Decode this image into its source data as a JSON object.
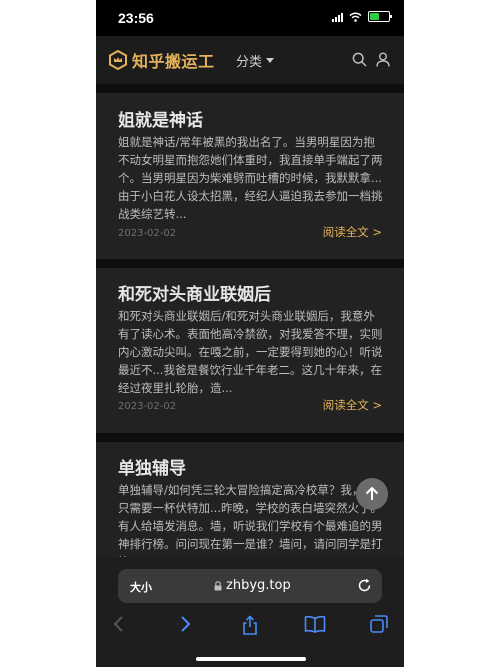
{
  "status_bar": {
    "time": "23:56"
  },
  "header": {
    "logo_text": "知乎搬运工",
    "category_label": "分类",
    "brand_color": "#e4b25a",
    "icons": [
      "search-icon",
      "user-icon"
    ]
  },
  "articles": [
    {
      "title": "姐就是神话",
      "excerpt": "姐就是神话/常年被黑的我出名了。当男明星因为抱不动女明星而抱怨她们体重时，我直接单手端起了两个。当男明星因为柴难劈而吐槽的时候，我默默拿...由于小白花人设太招黑，经纪人逼迫我去参加一档挑战类综艺转...",
      "date": "2023-02-02",
      "read_more": "阅读全文 >"
    },
    {
      "title": "和死对头商业联姻后",
      "excerpt": "和死对头商业联姻后/和死对头商业联姻后，我意外有了读心术。表面他高冷禁欲，对我爱答不理，实则内心激动尖叫。在嘎之前，一定要得到她的心！听说最近不...我爸是餐饮行业千年老二。这几十年来，在经过夜里扎轮胎，造...",
      "date": "2023-02-02",
      "read_more": "阅读全文 >"
    },
    {
      "title": "单独辅导",
      "excerpt": "单独辅导/如何凭三轮大冒险搞定高冷校草？我，你只需要一杯伏特加...昨晚，学校的表白墙突然火了。有人给墙发消息。墙，听说我们学校有个最难追的男神排行榜。问问现在第一是谁？墙问，请问同学是打算..."
    }
  ],
  "browser": {
    "text_size_label": "大小",
    "url": "zhbyg.top"
  }
}
